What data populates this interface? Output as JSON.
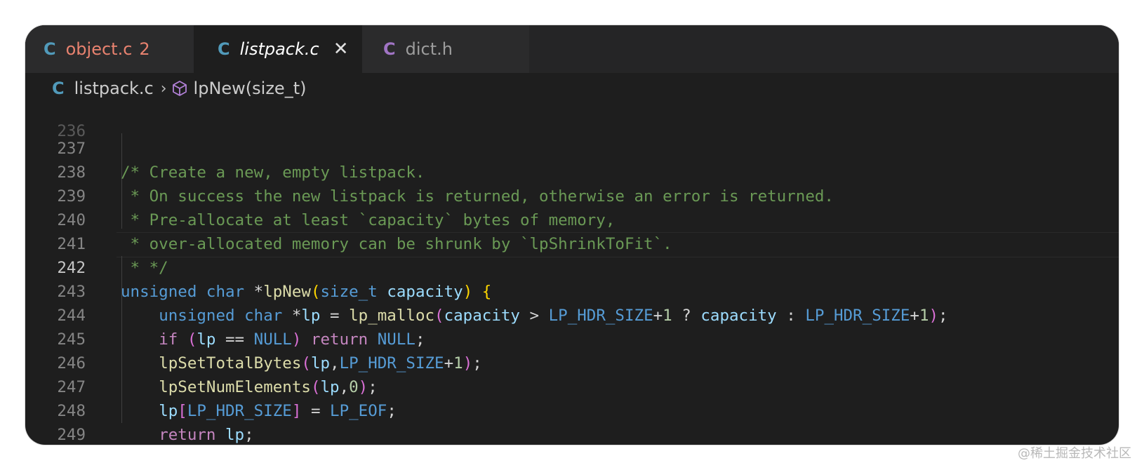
{
  "tabs": [
    {
      "icon": "C",
      "label": "object.c",
      "badge": "2"
    },
    {
      "icon": "C",
      "label": "listpack.c",
      "close": "✕"
    },
    {
      "icon": "C",
      "label": "dict.h"
    }
  ],
  "breadcrumb": {
    "icon": "C",
    "file": "listpack.c",
    "separator": "›",
    "symbol": "lpNew(size_t)"
  },
  "editor": {
    "line_numbers": [
      "237",
      "238",
      "239",
      "240",
      "241",
      "242",
      "243",
      "244",
      "245",
      "246",
      "247",
      "248",
      "249"
    ],
    "current_line": "242"
  },
  "watermark": "@稀土掘金技术社区"
}
